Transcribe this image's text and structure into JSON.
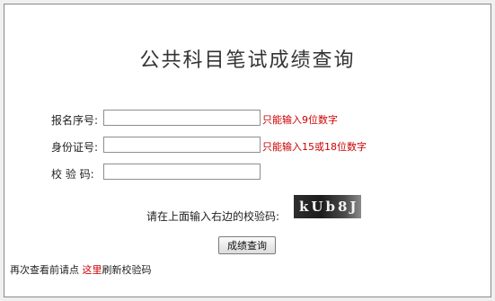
{
  "page": {
    "title": "公共科目笔试成绩查询"
  },
  "form": {
    "reg_no": {
      "label": "报名序号:",
      "value": "",
      "hint": "只能输入9位数字"
    },
    "id_no": {
      "label": "身份证号:",
      "value": "",
      "hint": "只能输入15或18位数字"
    },
    "captcha_field": {
      "label": "校 验 码:",
      "value": ""
    }
  },
  "captcha": {
    "prompt": "请在上面输入右边的校验码:",
    "text": "kUb8J"
  },
  "submit": {
    "label": "成绩查询"
  },
  "footer": {
    "text_before": "再次查看前请点",
    "link": "这里",
    "text_after": "刷新校验码"
  },
  "colors": {
    "hint": "#cc0000",
    "link": "#cc0000"
  }
}
